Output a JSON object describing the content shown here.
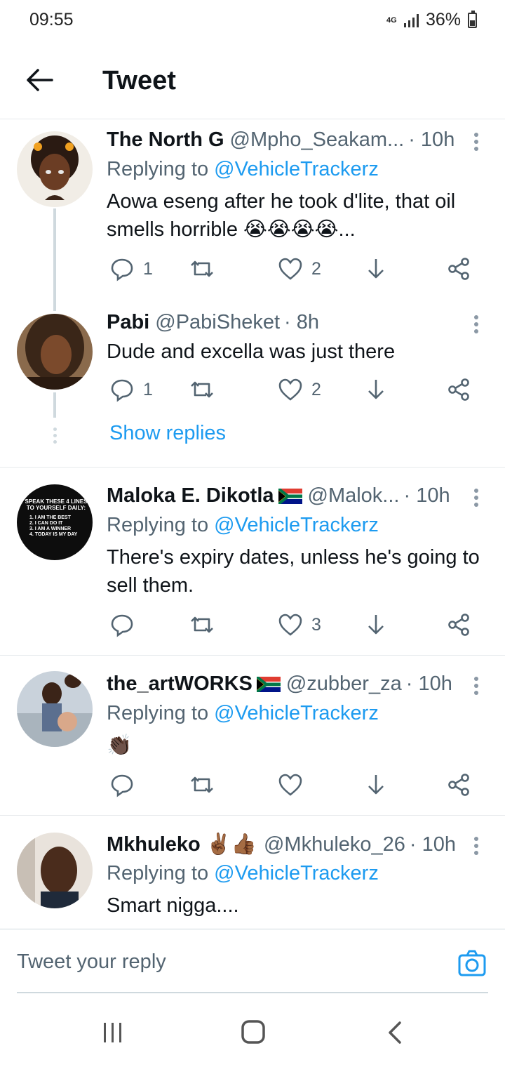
{
  "status": {
    "time": "09:55",
    "network": "4G",
    "battery": "36%"
  },
  "header": {
    "title": "Tweet"
  },
  "tweets": [
    {
      "name": "The North G",
      "handle": "@Mpho_Seakam...",
      "time": "· 10h",
      "replying_label": "Replying to",
      "replying_to": "@VehicleTrackerz",
      "text": "Aowa eseng after he took d'lite, that oil smells horrible 😭😭😭😭...",
      "replies": "1",
      "retweets": "",
      "likes": "2"
    },
    {
      "name": "Pabi",
      "handle": "@PabiSheket",
      "time": "· 8h",
      "text": "Dude and excella was just there",
      "replies": "1",
      "retweets": "",
      "likes": "2",
      "show_replies": "Show replies"
    },
    {
      "name": "Maloka E. Dikotla",
      "handle": "@Malok...",
      "time": "· 10h",
      "replying_label": "Replying to",
      "replying_to": "@VehicleTrackerz",
      "text": "There's expiry dates, unless he's going to sell them.",
      "replies": "",
      "retweets": "",
      "likes": "3",
      "avatar_lines": [
        "SPEAK THESE 4 LINES",
        "TO YOURSELF DAILY:",
        "1. I AM THE BEST",
        "2. I CAN DO IT",
        "3. I AM A WINNER",
        "4. TODAY IS MY DAY"
      ]
    },
    {
      "name": "the_artWORKS",
      "handle": "@zubber_za",
      "time": "· 10h",
      "replying_label": "Replying to",
      "replying_to": "@VehicleTrackerz",
      "text": "👏🏿",
      "replies": "",
      "retweets": "",
      "likes": ""
    },
    {
      "name": "Mkhuleko",
      "name_emoji": "✌🏾👍🏾",
      "handle": "@Mkhuleko_26",
      "time": "· 10h",
      "replying_label": "Replying to",
      "replying_to": "@VehicleTrackerz",
      "text": "Smart nigga...."
    }
  ],
  "reply_bar": {
    "placeholder": "Tweet your reply"
  },
  "colors": {
    "link": "#1d9bf0",
    "muted": "#536471",
    "text": "#0f1419",
    "divider": "#e6e9ec"
  },
  "icons": [
    "back-arrow-icon",
    "reply-icon",
    "retweet-icon",
    "like-icon",
    "bookmark-icon",
    "share-icon",
    "more-icon",
    "camera-icon",
    "recents-icon",
    "home-icon",
    "back-nav-icon"
  ]
}
